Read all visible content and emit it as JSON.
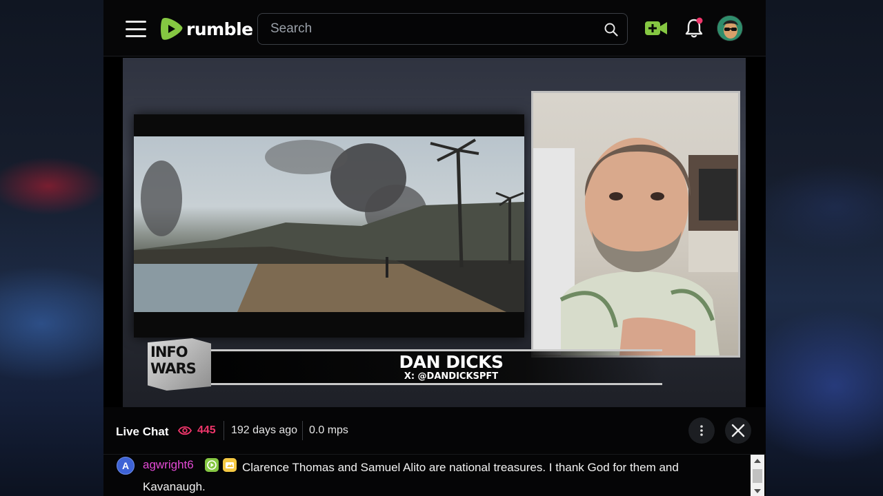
{
  "header": {
    "brand_name": "rumble",
    "search_placeholder": "Search",
    "icons": [
      "menu-icon",
      "search-icon",
      "go-live-icon",
      "notification-bell-icon",
      "user-avatar"
    ],
    "accent_color": "#85c742",
    "notification_dot_color": "#f0366b"
  },
  "video": {
    "lower_third": {
      "logo_line1": "INFO",
      "logo_line2": "WARS",
      "name": "DAN DICKS",
      "handle": "X: @DANDICKSPFT"
    }
  },
  "chat": {
    "title": "Live Chat",
    "viewer_count": "445",
    "time_ago": "192 days ago",
    "rate": "0.0 mps",
    "messages": [
      {
        "avatar_letter": "A",
        "username": "agwright6",
        "text": "Clarence Thomas and Samuel Alito are national treasures. I thank God for them and Kavanaugh."
      }
    ]
  }
}
